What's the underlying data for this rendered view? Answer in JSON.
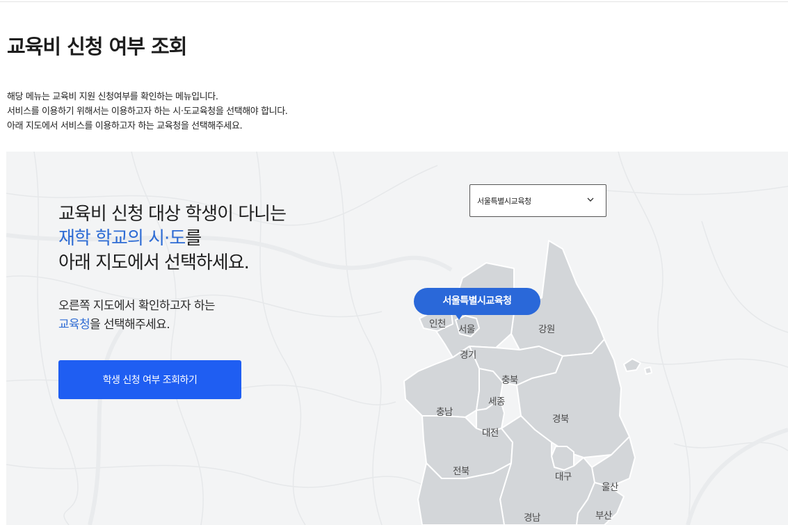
{
  "page": {
    "title": "교육비 신청 여부 조회",
    "intro": [
      "해당 메뉴는 교육비 지원 신청여부를 확인하는 메뉴입니다.",
      "서비스를 이용하기 위해서는 이용하고자 하는 시·도교육청을 선택해야 합니다.",
      "아래 지도에서 서비스를 이용하고자 하는 교육청을 선택해주세요."
    ]
  },
  "panel": {
    "heading": {
      "line1": "교육비 신청 대상 학생이 다니는",
      "line2_highlight": "재학 학교의 시·도",
      "line2_rest": "를",
      "line3": "아래 지도에서 선택하세요."
    },
    "subtext": {
      "line1": "오른쪽 지도에서 확인하고자 하는",
      "line2_highlight": "교육청",
      "line2_rest": "을 선택해주세요."
    },
    "cta_label": "학생 신청 여부 조회하기"
  },
  "office_select": {
    "selected": "서울특별시교육청",
    "icon": "chevron-down-icon"
  },
  "map": {
    "selected_tooltip": "서울특별시교육청",
    "regions": [
      "인천",
      "서울",
      "강원",
      "경기",
      "충북",
      "세종",
      "충남",
      "경북",
      "대전",
      "전북",
      "대구",
      "울산",
      "경남",
      "부산"
    ]
  },
  "colors": {
    "accent": "#2d6bd4",
    "button": "#1f5ef2",
    "tooltip": "#2a68d9",
    "map_fill": "#d3d6d9",
    "map_border": "#ffffff",
    "panel_bg": "#f3f4f5"
  }
}
